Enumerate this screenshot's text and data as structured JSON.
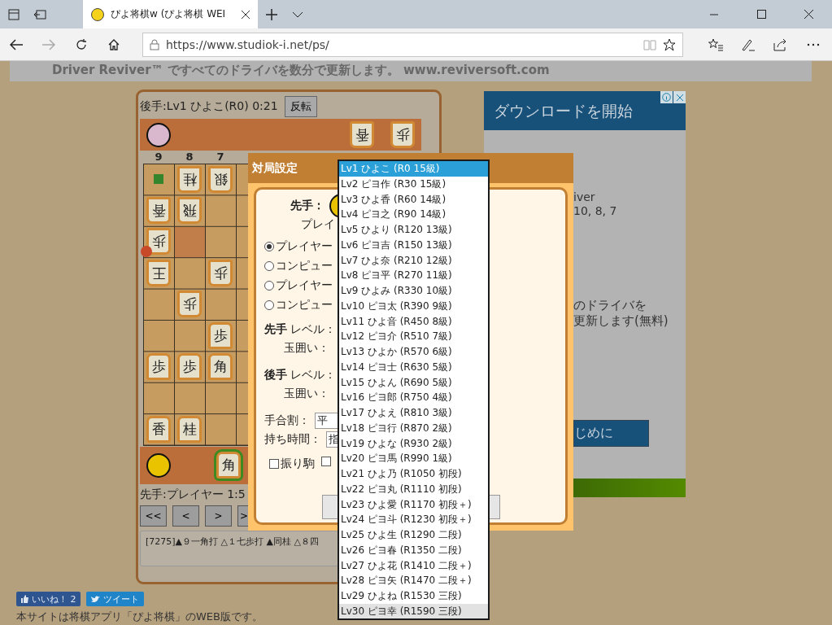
{
  "browser": {
    "tab_title": "ぴよ将棋w (ぴよ将棋 WEI",
    "url": "https://www.studiok-i.net/ps/"
  },
  "banner": {
    "text": "Driver Reviver™ ですべてのドライバを数分で更新します。 www.reviversoft.com"
  },
  "game": {
    "gote_label": "後手:Lv1 ひよこ(R0) 0:21",
    "flip_button": "反転",
    "gote_hand": [
      {
        "piece": "香"
      },
      {
        "piece": "歩"
      }
    ],
    "files": [
      "9",
      "8",
      "7"
    ],
    "board": [
      [
        {
          "kind": "mark"
        },
        {
          "kind": "piece",
          "piece": "桂",
          "inverted": true,
          "check": false
        },
        {
          "kind": "piece",
          "piece": "銀",
          "inverted": true,
          "check": false
        }
      ],
      [
        {
          "kind": "piece",
          "piece": "香",
          "inverted": true,
          "check": false
        },
        {
          "kind": "piece",
          "piece": "飛",
          "inverted": true,
          "check": false
        },
        {
          "kind": "empty"
        }
      ],
      [
        {
          "kind": "piece",
          "piece": "歩",
          "inverted": true,
          "check": false
        },
        {
          "kind": "highlight"
        },
        {
          "kind": "empty"
        }
      ],
      [
        {
          "kind": "piece",
          "piece": "王",
          "inverted": true,
          "check": true
        },
        {
          "kind": "empty"
        },
        {
          "kind": "piece",
          "piece": "歩",
          "inverted": true,
          "check": false
        }
      ],
      [
        {
          "kind": "empty"
        },
        {
          "kind": "piece",
          "piece": "歩",
          "inverted": true,
          "check": false
        },
        {
          "kind": "empty"
        }
      ],
      [
        {
          "kind": "empty"
        },
        {
          "kind": "empty"
        },
        {
          "kind": "piece",
          "piece": "歩",
          "inverted": false,
          "check": false
        }
      ],
      [
        {
          "kind": "piece",
          "piece": "歩",
          "inverted": false,
          "check": false
        },
        {
          "kind": "piece",
          "piece": "歩",
          "inverted": false,
          "check": false
        },
        {
          "kind": "piece",
          "piece": "角",
          "inverted": false,
          "check": false
        }
      ],
      [
        {
          "kind": "empty"
        },
        {
          "kind": "empty"
        },
        {
          "kind": "empty"
        }
      ],
      [
        {
          "kind": "piece",
          "piece": "香",
          "inverted": false,
          "check": false
        },
        {
          "kind": "piece",
          "piece": "桂",
          "inverted": false,
          "check": false
        },
        {
          "kind": "empty"
        }
      ]
    ],
    "sente_hand": [
      {
        "piece": "角",
        "selected": true
      }
    ],
    "sente_label": "先手:プレイヤー 1:5",
    "nav_buttons": [
      "<<",
      "<",
      ">",
      ">"
    ],
    "record": "[7275]▲９一角打 △１七歩打 ▲同桂 △８四"
  },
  "social": {
    "like": "いいね！",
    "like_count": "2",
    "tweet": "ツイート"
  },
  "footer_text": "本サイトは将棋アプリ「ぴよ将棋」のWEB版です。",
  "ad": {
    "title": "ダウンロードを開始",
    "lines_top": [
      "iver",
      "10, 8, 7"
    ],
    "lines_mid": [
      "のドライバを",
      "更新します(無料)"
    ],
    "button": "じめに"
  },
  "dialog": {
    "title": "対局設定",
    "sente_label": "先手：",
    "player_text": "プレイ",
    "radios": [
      {
        "label": "プレイヤー",
        "selected": true
      },
      {
        "label": "コンピュー",
        "selected": false
      },
      {
        "label": "プレイヤー",
        "selected": false
      },
      {
        "label": "コンピュー",
        "selected": false
      }
    ],
    "settings": [
      {
        "kind": "level",
        "label": "**先手** レベル："
      },
      {
        "kind": "sub",
        "label": "玉囲い："
      },
      {
        "kind": "level",
        "label": "**後手** レベル："
      },
      {
        "kind": "sub",
        "label": "玉囲い："
      },
      {
        "kind": "select",
        "label": "手合割：",
        "value": "平"
      },
      {
        "kind": "select",
        "label": "持ち時間：",
        "value": "指"
      }
    ],
    "checkboxes": [
      {
        "label": "振り駒",
        "checked": false
      },
      {
        "checked": false
      }
    ]
  },
  "dropdown": {
    "options": [
      {
        "label": "Lv1 ひよこ (R0 15級)",
        "selected": true,
        "hovered": false
      },
      {
        "label": "Lv2 ピヨ作 (R30 15級)",
        "selected": false,
        "hovered": false
      },
      {
        "label": "Lv3 ひよ香 (R60 14級)",
        "selected": false,
        "hovered": false
      },
      {
        "label": "Lv4 ピヨ之 (R90 14級)",
        "selected": false,
        "hovered": false
      },
      {
        "label": "Lv5 ひより (R120 13級)",
        "selected": false,
        "hovered": false
      },
      {
        "label": "Lv6 ピヨ吉 (R150 13級)",
        "selected": false,
        "hovered": false
      },
      {
        "label": "Lv7 ひよ奈 (R210 12級)",
        "selected": false,
        "hovered": false
      },
      {
        "label": "Lv8 ピヨ平 (R270 11級)",
        "selected": false,
        "hovered": false
      },
      {
        "label": "Lv9 ひよみ (R330 10級)",
        "selected": false,
        "hovered": false
      },
      {
        "label": "Lv10 ピヨ太 (R390 9級)",
        "selected": false,
        "hovered": false
      },
      {
        "label": "Lv11 ひよ音 (R450 8級)",
        "selected": false,
        "hovered": false
      },
      {
        "label": "Lv12 ピヨ介 (R510 7級)",
        "selected": false,
        "hovered": false
      },
      {
        "label": "Lv13 ひよか (R570 6級)",
        "selected": false,
        "hovered": false
      },
      {
        "label": "Lv14 ピヨ士 (R630 5級)",
        "selected": false,
        "hovered": false
      },
      {
        "label": "Lv15 ひよん (R690 5級)",
        "selected": false,
        "hovered": false
      },
      {
        "label": "Lv16 ピヨ郎 (R750 4級)",
        "selected": false,
        "hovered": false
      },
      {
        "label": "Lv17 ひよえ (R810 3級)",
        "selected": false,
        "hovered": false
      },
      {
        "label": "Lv18 ピヨ行 (R870 2級)",
        "selected": false,
        "hovered": false
      },
      {
        "label": "Lv19 ひよな (R930 2級)",
        "selected": false,
        "hovered": false
      },
      {
        "label": "Lv20 ピヨ馬 (R990 1級)",
        "selected": false,
        "hovered": false
      },
      {
        "label": "Lv21 ひよ乃 (R1050 初段)",
        "selected": false,
        "hovered": false
      },
      {
        "label": "Lv22 ピヨ丸 (R1110 初段)",
        "selected": false,
        "hovered": false
      },
      {
        "label": "Lv23 ひよ愛 (R1170 初段＋)",
        "selected": false,
        "hovered": false
      },
      {
        "label": "Lv24 ピヨ斗 (R1230 初段＋)",
        "selected": false,
        "hovered": false
      },
      {
        "label": "Lv25 ひよ生 (R1290 二段)",
        "selected": false,
        "hovered": false
      },
      {
        "label": "Lv26 ピヨ春 (R1350 二段)",
        "selected": false,
        "hovered": false
      },
      {
        "label": "Lv27 ひよ花 (R1410 二段＋)",
        "selected": false,
        "hovered": false
      },
      {
        "label": "Lv28 ピヨ矢 (R1470 二段＋)",
        "selected": false,
        "hovered": false
      },
      {
        "label": "Lv29 ひよね (R1530 三段)",
        "selected": false,
        "hovered": false
      },
      {
        "label": "Lv30 ピヨ幸 (R1590 三段)",
        "selected": false,
        "hovered": true
      }
    ]
  }
}
